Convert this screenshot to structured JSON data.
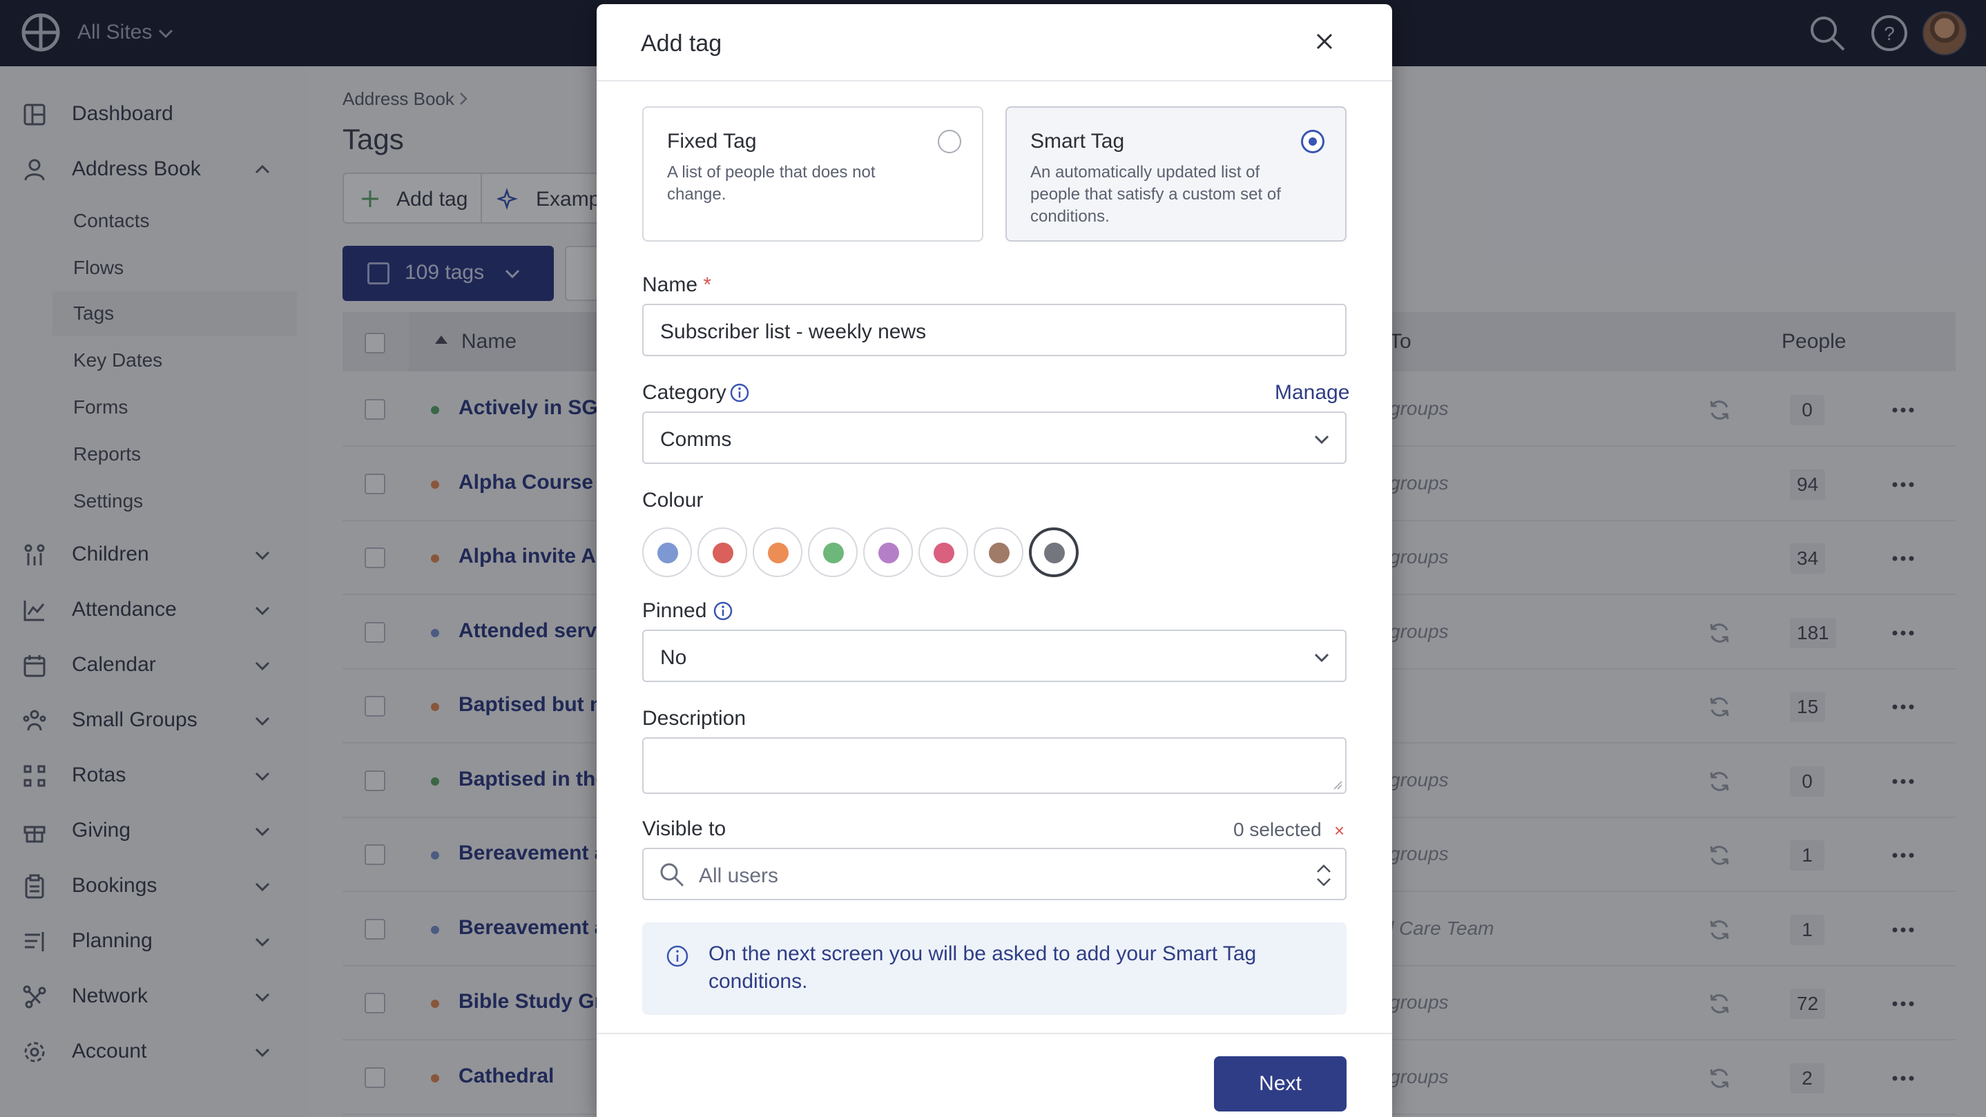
{
  "topbar": {
    "site_selector": "All Sites"
  },
  "sidebar": {
    "items": [
      {
        "label": "Dashboard",
        "icon": "dashboard-icon"
      },
      {
        "label": "Address Book",
        "icon": "person-icon",
        "expanded": true
      },
      {
        "label": "Children",
        "icon": "children-icon"
      },
      {
        "label": "Attendance",
        "icon": "attendance-chart-icon"
      },
      {
        "label": "Calendar",
        "icon": "calendar-icon"
      },
      {
        "label": "Small Groups",
        "icon": "small-groups-icon"
      },
      {
        "label": "Rotas",
        "icon": "rotas-icon"
      },
      {
        "label": "Giving",
        "icon": "gift-icon"
      },
      {
        "label": "Bookings",
        "icon": "clipboard-icon"
      },
      {
        "label": "Planning",
        "icon": "planning-icon"
      },
      {
        "label": "Network",
        "icon": "network-icon"
      },
      {
        "label": "Account",
        "icon": "gear-icon"
      }
    ],
    "address_book_sub": [
      "Contacts",
      "Flows",
      "Tags",
      "Key Dates",
      "Forms",
      "Reports",
      "Settings"
    ],
    "active_sub": "Tags"
  },
  "page": {
    "breadcrumb": "Address Book",
    "title": "Tags",
    "add_tag_button": "Add tag",
    "examples_button": "Examp",
    "count_button": "109 tags",
    "table_headers": {
      "name": "Name",
      "visible_to": "To",
      "people": "People"
    },
    "rows": [
      {
        "name": "Actively in SG",
        "dot": "#5ea86b",
        "visible": "groups",
        "sync": true,
        "people": "0"
      },
      {
        "name": "Alpha Course In",
        "dot": "#e38a56",
        "visible": "groups",
        "sync": false,
        "people": "94"
      },
      {
        "name": "Alpha invite Au",
        "dot": "#e38a56",
        "visible": "groups",
        "sync": false,
        "people": "34"
      },
      {
        "name": "Attended servi",
        "dot": "#7a94cf",
        "visible": "groups",
        "sync": true,
        "people": "181"
      },
      {
        "name": "Baptised but no",
        "dot": "#e38a56",
        "visible": "",
        "sync": true,
        "people": "15"
      },
      {
        "name": "Baptised in the",
        "dot": "#5ea86b",
        "visible": "groups",
        "sync": true,
        "people": "0"
      },
      {
        "name": "Bereavement a",
        "dot": "#7a94cf",
        "visible": "groups",
        "sync": true,
        "people": "1"
      },
      {
        "name": "Bereavement a",
        "dot": "#7a94cf",
        "visible": "l Care Team",
        "sync": true,
        "people": "1"
      },
      {
        "name": "Bible Study Gro",
        "dot": "#e38a56",
        "visible": "groups",
        "sync": true,
        "people": "72"
      },
      {
        "name": "Cathedral",
        "dot": "#e38a56",
        "visible": "groups",
        "sync": true,
        "people": "2"
      }
    ]
  },
  "modal": {
    "title": "Add tag",
    "fixed": {
      "title": "Fixed Tag",
      "desc": "A list of people that does not change."
    },
    "smart": {
      "title": "Smart Tag",
      "desc": "An automatically updated list of people that satisfy a custom set of conditions."
    },
    "selected_type": "smart",
    "name_label": "Name",
    "required_mark": "*",
    "name_value": "Subscriber list - weekly news",
    "category_label": "Category",
    "manage_link": "Manage",
    "category_value": "Comms",
    "colour_label": "Colour",
    "colours": [
      "#7d98d3",
      "#d9605b",
      "#ec8d55",
      "#6db77a",
      "#b57fc8",
      "#d9607f",
      "#a07b68",
      "#74767d"
    ],
    "selected_colour_index": 7,
    "pinned_label": "Pinned",
    "pinned_value": "No",
    "description_label": "Description",
    "description_value": "",
    "visible_label": "Visible to",
    "visible_count": "0 selected",
    "visible_clear": "×",
    "visible_value": "All users",
    "notice": "On the next screen you will be asked to add your Smart Tag conditions.",
    "next_button": "Next"
  },
  "colors": {
    "topbar": "#1e2235",
    "primary": "#2f3d86",
    "accent_radio": "#3a55b4"
  }
}
